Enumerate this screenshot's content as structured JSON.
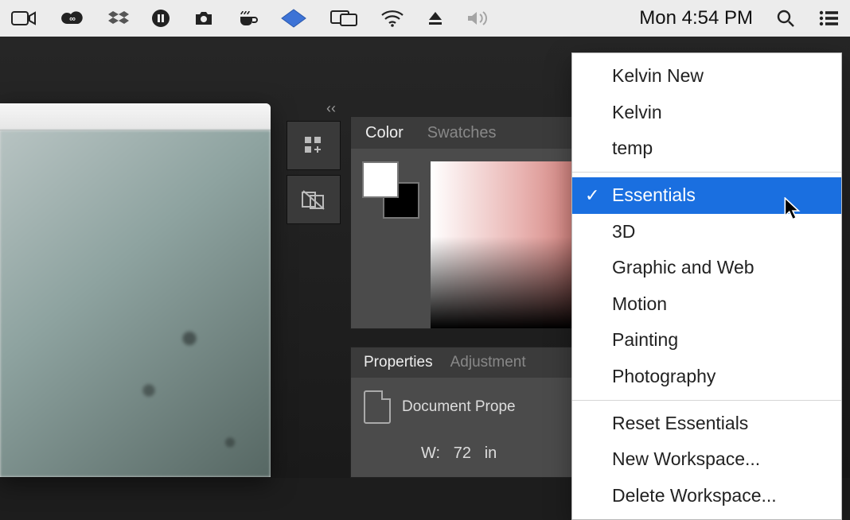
{
  "menubar": {
    "clock": "Mon 4:54 PM"
  },
  "panelstrip": {
    "collapse_glyph": "‹‹"
  },
  "color_panel": {
    "tab_color": "Color",
    "tab_swatches": "Swatches"
  },
  "properties_panel": {
    "tab_properties": "Properties",
    "tab_adjustments": "Adjustment",
    "doc_label": "Document Prope",
    "width_label": "W:",
    "width_value": "72",
    "width_unit": "in"
  },
  "workspace_menu": {
    "group1": [
      "Kelvin New",
      "Kelvin",
      "temp"
    ],
    "group2": [
      "Essentials",
      "3D",
      "Graphic and Web",
      "Motion",
      "Painting",
      "Photography"
    ],
    "group3": [
      "Reset Essentials",
      "New Workspace...",
      "Delete Workspace..."
    ],
    "selected": "Essentials",
    "checkmark": "✓"
  }
}
